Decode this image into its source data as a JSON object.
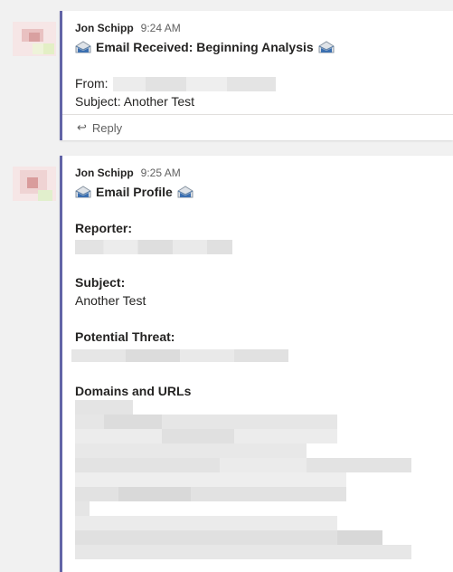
{
  "messages": [
    {
      "author": "Jon Schipp",
      "time": "9:24 AM",
      "title": "Email Received: Beginning Analysis",
      "from_label": "From:",
      "subject_line": "Subject: Another Test",
      "reply_label": "Reply"
    },
    {
      "author": "Jon Schipp",
      "time": "9:25 AM",
      "title": "Email Profile",
      "reporter_label": "Reporter:",
      "subject_label": "Subject:",
      "subject_value": "Another Test",
      "threat_label": "Potential Threat:",
      "domains_label": "Domains and URLs"
    }
  ],
  "icons": {
    "mail": "mail-open-icon",
    "reply": "reply-arrow-icon"
  },
  "colors": {
    "accent": "#6264a7",
    "background": "#f1f1f1",
    "card": "#ffffff"
  }
}
